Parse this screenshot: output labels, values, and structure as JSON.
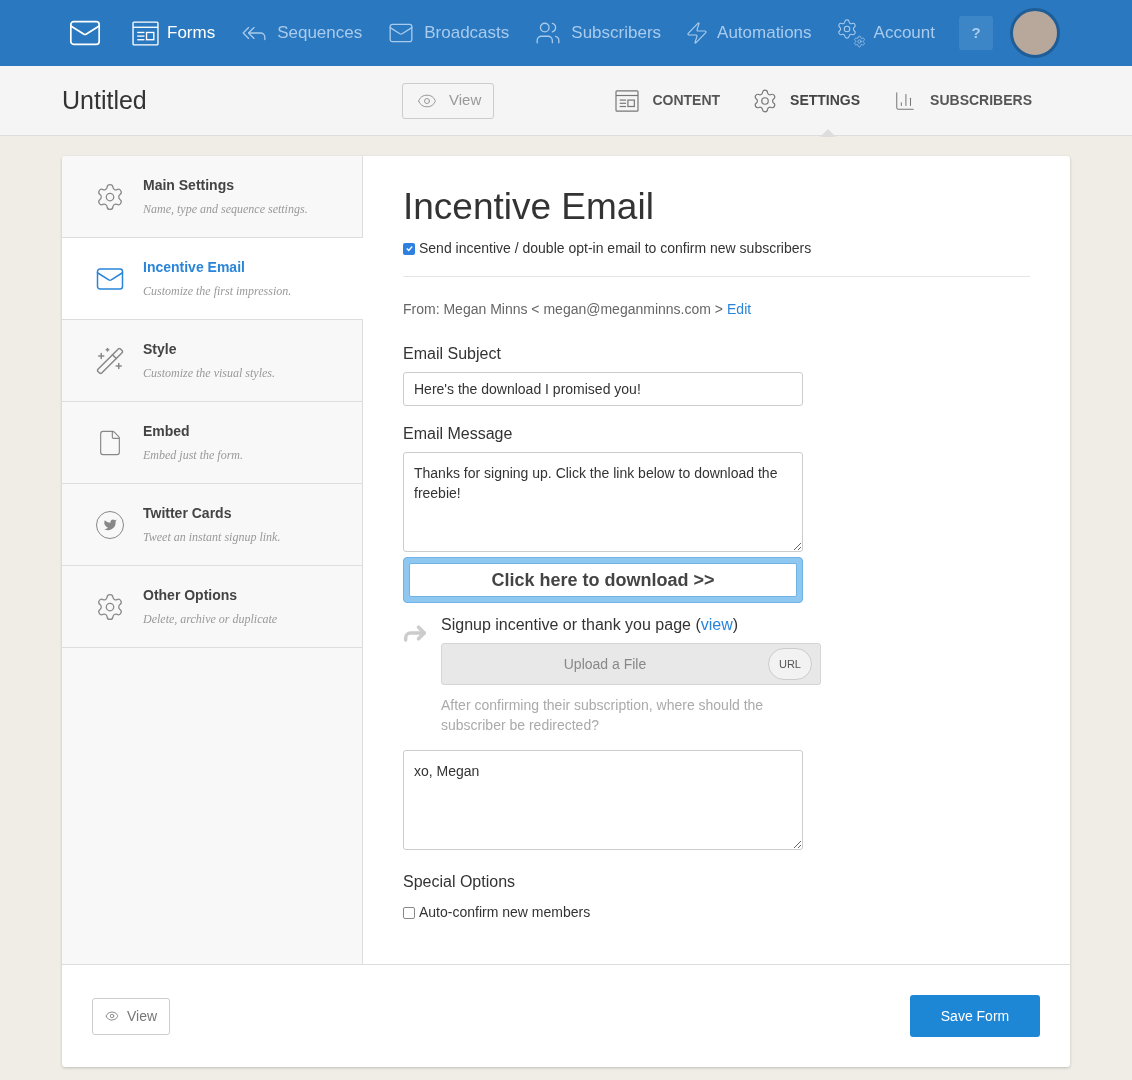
{
  "nav": {
    "items": [
      {
        "label": "Forms",
        "selected": true
      },
      {
        "label": "Sequences",
        "selected": false
      },
      {
        "label": "Broadcasts",
        "selected": false
      },
      {
        "label": "Subscribers",
        "selected": false
      },
      {
        "label": "Automations",
        "selected": false
      },
      {
        "label": "Account",
        "selected": false
      }
    ],
    "help": "?"
  },
  "header": {
    "title": "Untitled",
    "view_button": "View",
    "tabs": [
      {
        "label": "CONTENT",
        "selected": false
      },
      {
        "label": "SETTINGS",
        "selected": true
      },
      {
        "label": "SUBSCRIBERS",
        "selected": false
      }
    ]
  },
  "sidebar": {
    "items": [
      {
        "title": "Main Settings",
        "subtitle": "Name, type and sequence settings.",
        "selected": false
      },
      {
        "title": "Incentive Email",
        "subtitle": "Customize the first impression.",
        "selected": true
      },
      {
        "title": "Style",
        "subtitle": "Customize the visual styles.",
        "selected": false
      },
      {
        "title": "Embed",
        "subtitle": "Embed just the form.",
        "selected": false
      },
      {
        "title": "Twitter Cards",
        "subtitle": "Tweet an instant signup link.",
        "selected": false
      },
      {
        "title": "Other Options",
        "subtitle": "Delete, archive or duplicate",
        "selected": false
      }
    ]
  },
  "main": {
    "heading": "Incentive Email",
    "send_incentive": {
      "label": "Send incentive / double opt-in email to confirm new subscribers",
      "checked": true
    },
    "from": {
      "text": "From: Megan Minns < megan@meganminns.com >",
      "link": "Edit"
    },
    "subject": {
      "label": "Email Subject",
      "value": "Here's the download I promised you!"
    },
    "message": {
      "label": "Email Message",
      "value": "Thanks for signing up. Click the link below to download the freebie!"
    },
    "download_button": "Click here to download >>",
    "redirect": {
      "label_before": "Signup incentive or thank you page (",
      "link": "view",
      "label_after": ")",
      "upload": "Upload a File",
      "url_button": "URL",
      "hint": "After confirming their subscription, where should the subscriber be redirected?"
    },
    "signature": {
      "value": "xo, Megan"
    },
    "special_options": {
      "heading": "Special Options",
      "auto_confirm": {
        "label": "Auto-confirm new members",
        "checked": false
      }
    }
  },
  "footer": {
    "view_button": "View",
    "save_button": "Save Form"
  }
}
